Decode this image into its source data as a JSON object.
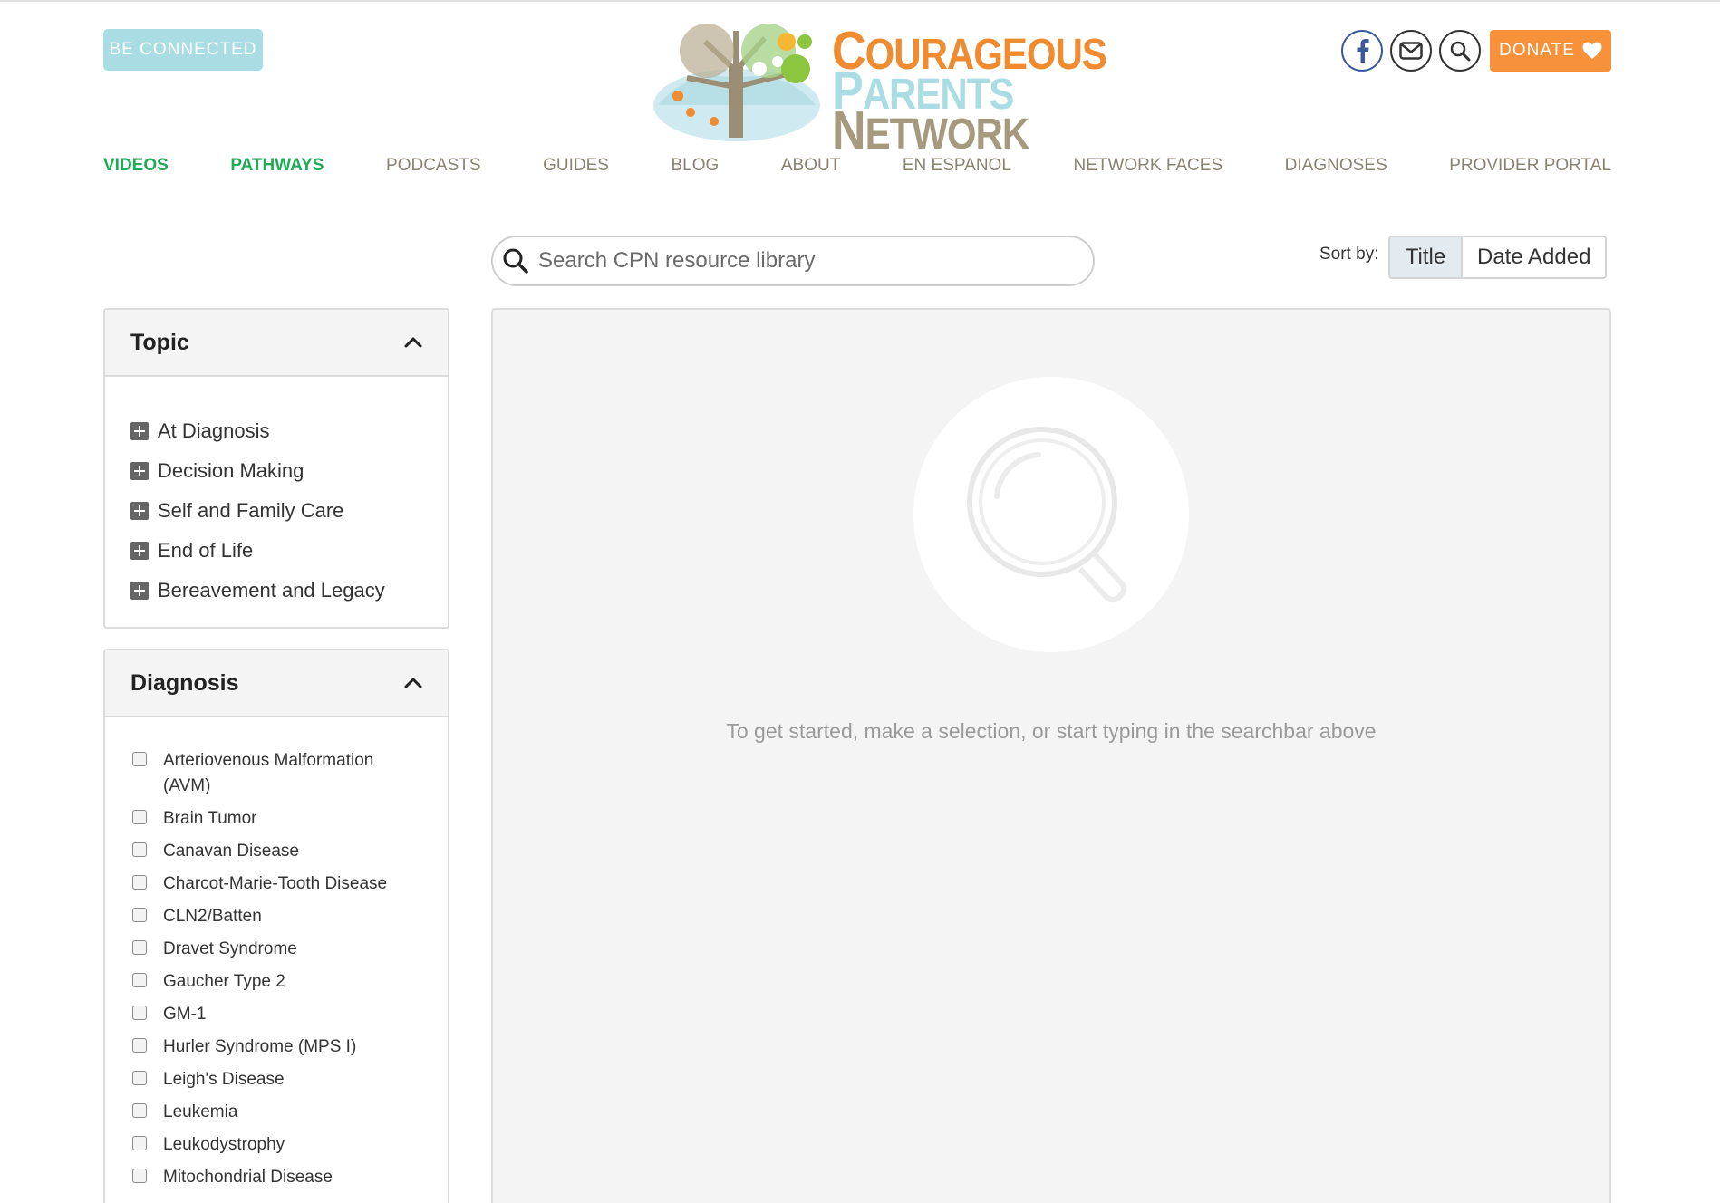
{
  "header": {
    "be_connected": "BE CONNECTED",
    "logo": {
      "line1": "Courageous",
      "line2": "Parents",
      "line3": "Network"
    },
    "donate": "DONATE"
  },
  "nav": {
    "items": [
      {
        "label": "VIDEOS",
        "highlight": true
      },
      {
        "label": "PATHWAYS",
        "highlight": true
      },
      {
        "label": "PODCASTS",
        "highlight": false
      },
      {
        "label": "GUIDES",
        "highlight": false
      },
      {
        "label": "BLOG",
        "highlight": false
      },
      {
        "label": "ABOUT",
        "highlight": false
      },
      {
        "label": "EN ESPANOL",
        "highlight": false
      },
      {
        "label": "NETWORK FACES",
        "highlight": false
      },
      {
        "label": "DIAGNOSES",
        "highlight": false
      },
      {
        "label": "PROVIDER PORTAL",
        "highlight": false
      }
    ]
  },
  "search": {
    "placeholder": "Search CPN resource library",
    "value": ""
  },
  "sort": {
    "label": "Sort by:",
    "options": [
      "Title",
      "Date Added"
    ],
    "selected": "Title"
  },
  "topic_panel": {
    "title": "Topic",
    "items": [
      "At Diagnosis",
      "Decision Making",
      "Self and Family Care",
      "End of Life",
      "Bereavement and Legacy"
    ]
  },
  "diagnosis_panel": {
    "title": "Diagnosis",
    "items": [
      "Arteriovenous Malformation (AVM)",
      "Brain Tumor",
      "Canavan Disease",
      "Charcot-Marie-Tooth Disease",
      "CLN2/Batten",
      "Dravet Syndrome",
      "Gaucher Type 2",
      "GM-1",
      "Hurler Syndrome (MPS I)",
      "Leigh's Disease",
      "Leukemia",
      "Leukodystrophy",
      "Mitochondrial Disease"
    ]
  },
  "results": {
    "empty_message": "To get started, make a selection, or start typing in the searchbar above"
  },
  "colors": {
    "accent_green": "#1faa57",
    "donate_orange": "#f7913a",
    "be_connected_blue": "#a9dde3",
    "nav_gray": "#8a8270"
  },
  "icons": [
    "facebook-icon",
    "mail-icon",
    "search-icon",
    "heart-icon",
    "chevron-up-icon",
    "plus-icon",
    "magnifier-placeholder-icon"
  ]
}
